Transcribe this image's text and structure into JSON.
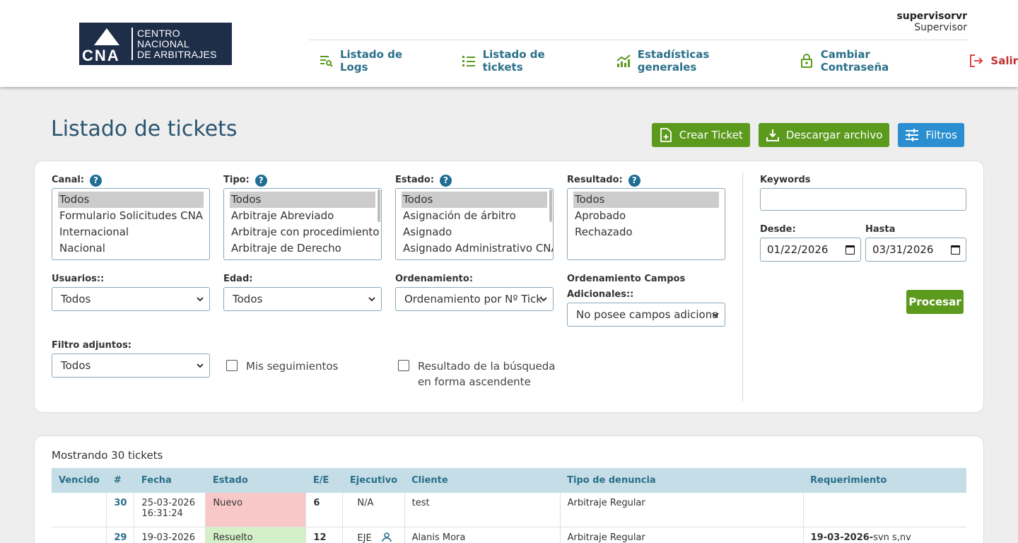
{
  "header": {
    "logo_lines": [
      "CENTRO",
      "NACIONAL",
      "DE ARBITRAJES"
    ],
    "logo_mark": "CNA",
    "user_name": "supervisorvr",
    "user_role": "Supervisor"
  },
  "nav": [
    {
      "label": "Listado de Logs",
      "icon": "log-list-icon"
    },
    {
      "label": "Listado de tickets",
      "icon": "list-icon"
    },
    {
      "label": "Estadísticas generales",
      "icon": "chart-icon"
    },
    {
      "label": "Cambiar Contraseña",
      "icon": "lock-icon"
    },
    {
      "label": "Salir",
      "icon": "logout-icon"
    }
  ],
  "page": {
    "title": "Listado de tickets",
    "actions": {
      "create": "Crear Ticket",
      "download": "Descargar archivo",
      "filters": "Filtros"
    }
  },
  "filters": {
    "canal": {
      "label": "Canal:",
      "options": [
        "Todos",
        "Formulario Solicitudes CNA",
        "Internacional",
        "Nacional"
      ],
      "selected": "Todos"
    },
    "tipo": {
      "label": "Tipo:",
      "options": [
        "Todos",
        "Arbitraje Abreviado",
        "Arbitraje con procedimiento a",
        "Arbitraje de Derecho"
      ],
      "selected": "Todos"
    },
    "estado": {
      "label": "Estado:",
      "options": [
        "Todos",
        "Asignación de árbitro",
        "Asignado",
        "Asignado Administrativo CNA"
      ],
      "selected": "Todos"
    },
    "resultado": {
      "label": "Resultado:",
      "options": [
        "Todos",
        "Aprobado",
        "Rechazado"
      ],
      "selected": "Todos"
    },
    "usuarios": {
      "label": "Usuarios::",
      "value": "Todos"
    },
    "edad": {
      "label": "Edad:",
      "value": "Todos"
    },
    "ordenamiento": {
      "label": "Ordenamiento:",
      "value": "Ordenamiento por Nº Tick"
    },
    "ordenamiento_campos": {
      "label_line1": "Ordenamiento Campos",
      "label_line2": "Adicionales::",
      "value": "No posee campos adiciona"
    },
    "adjuntos": {
      "label": "Filtro adjuntos:",
      "value": "Todos"
    },
    "mis_seguimientos": {
      "label": "Mis seguimientos",
      "checked": false
    },
    "ascendente": {
      "label_line1": "Resultado de la búsqueda",
      "label_line2": "en forma ascendente",
      "checked": false
    },
    "keywords": {
      "label": "Keywords",
      "value": ""
    },
    "desde": {
      "label": "Desde:",
      "value": "01/22/2026"
    },
    "hasta": {
      "label": "Hasta",
      "value": "03/31/2026"
    },
    "procesar": "Procesar"
  },
  "results": {
    "count_text": "Mostrando 30 tickets",
    "columns": [
      "Vencido",
      "#",
      "Fecha",
      "Estado",
      "E/E",
      "Ejecutivo",
      "Cliente",
      "Tipo de denuncia",
      "Requerimiento"
    ],
    "rows": [
      {
        "vencido": "",
        "num": "30",
        "fecha_date": "25-03-2026",
        "fecha_time": "16:31:24",
        "estado": "Nuevo",
        "ee": "6",
        "ejecutivo": "N/A",
        "cliente": "test",
        "tipo": "Arbitraje Regular",
        "req_bold": "",
        "req_text": ""
      },
      {
        "vencido": "",
        "num": "29",
        "fecha_date": "19-03-2026",
        "fecha_time": "",
        "estado": "Resuelto",
        "ee": "12",
        "ejecutivo": "EJE",
        "cliente": "Alanis Mora",
        "tipo": "Arbitraje Regular",
        "req_bold": "19-03-2026-",
        "req_text": "svn s,nv"
      }
    ]
  },
  "colors": {
    "brand": "#1e2d48",
    "accent_green": "#5c9a1e",
    "accent_blue": "#2a8ed0",
    "nav_text": "#2a6f8a",
    "logout": "#c03030",
    "status_nuevo": "#f8c8c8",
    "status_resuelto": "#d4f0c8"
  }
}
